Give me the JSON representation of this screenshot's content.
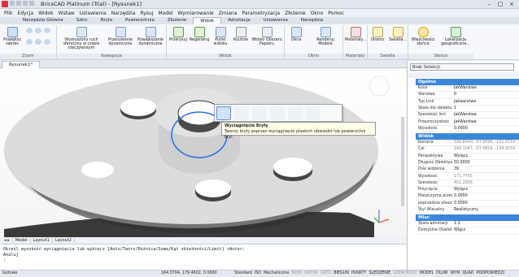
{
  "titlebar": {
    "title": "BricsCAD Platinum (Trial) - [Rysunek1]"
  },
  "menu": [
    "Plik",
    "Edycja",
    "Widok",
    "Wstaw",
    "Ustawienia",
    "Narzędzia",
    "Rysuj",
    "Model",
    "Wymiarowanie",
    "Zmiana",
    "Parametryzacja",
    "Złożenie",
    "Okno",
    "Pomoc"
  ],
  "ribbon_tabs": [
    "Narzędzia Główne",
    "Szkic",
    "Bryła",
    "Powierzchnia",
    "Złożenie",
    "Widok",
    "Adnotacja",
    "Ustawienia",
    "Narzędzia"
  ],
  "ribbon_active_tab": "Widok",
  "ribbon": {
    "zoom_label": "Zoom",
    "zoom_tool": "Powiększ zakres",
    "nav_label": "Nawigacja",
    "nav_tools": [
      "Wymuszony ruch sferyczny w czasie rzeczywistym",
      "Przesuwanie dynamiczne",
      "Powiększanie dynamiczne"
    ],
    "view_label": "Widok",
    "view_tools": [
      "Przerysuj",
      "Regeneruj",
      "Punkt widoku",
      "Rzutnie",
      "Widoki Obszaru Papieru"
    ],
    "window_label": "Okno",
    "window_tools": [
      "Okna",
      "Renderuj Modele"
    ],
    "materials_label": "Materiały",
    "materials_tool": "Materiały...",
    "lights_label": "Światła",
    "lights_tools": [
      "Utwórz",
      "Światła..."
    ],
    "sun_label": "Słońce",
    "sun_tools": [
      "Właściwości słońca",
      "Lokalizacja geograficzna..."
    ]
  },
  "doc_tab": "Rysunek1*",
  "layout_tabs": [
    "Model",
    "Layout1",
    "Layout2"
  ],
  "popup": {
    "tooltip_title": "Wyciągnięcie Bryły",
    "tooltip_text": "Tworzy bryły poprzez wyciągnięcie płaskich obwiedni lub powierzchni bryl"
  },
  "command": {
    "line1": "Określ wysokość wyciągnięcia lub wybierz [Auto/Twórz/Różnica/Suma/Kąt zbieżności/Limit] <Auto>:",
    "line2": "Anuluj",
    "prompt": ":"
  },
  "properties": {
    "selection": "Brak Selekcji",
    "sections": [
      {
        "title": "Ogólne",
        "rows": [
          {
            "k": "Kolor",
            "v": "JakWarstwa"
          },
          {
            "k": "Warstwa",
            "v": "0"
          },
          {
            "k": "Typ Linii",
            "v": "Jakwarstwa"
          },
          {
            "k": "Skala dla obiektu",
            "v": "1"
          },
          {
            "k": "Szerokość linii",
            "v": "JakWarstwa"
          },
          {
            "k": "Przezroczystość",
            "v": "JakWarstwa"
          },
          {
            "k": "Wysokość",
            "v": "0.0000"
          }
        ]
      },
      {
        "title": "Widok",
        "rows": [
          {
            "k": "Kamera",
            "v": "189.8640, -57.9596, -131.0519"
          },
          {
            "k": "Cel",
            "v": "189.1047, -57.4816, -134.9154"
          },
          {
            "k": "Perspektywa",
            "v": "Wyłącz"
          },
          {
            "k": "Długość Obiektywu",
            "v": "50.0000"
          },
          {
            "k": "Pole widzenia",
            "v": "39"
          },
          {
            "k": "Wysokość",
            "v": "171.7755"
          },
          {
            "k": "Szerokość",
            "v": "402.2656"
          },
          {
            "k": "Przycięcie",
            "v": "Wyłącz"
          },
          {
            "k": "Płaszczyzna przednia",
            "v": "0.0000"
          },
          {
            "k": "poprzednia płaszczyzna",
            "v": "0.0000"
          },
          {
            "k": "Styl Wizualny",
            "v": "Realistyczny"
          }
        ]
      },
      {
        "title": "Misc",
        "rows": [
          {
            "k": "Skala adnotacji",
            "v": "1:1"
          },
          {
            "k": "Domyślne Oświetlenie",
            "v": "Włącz"
          }
        ]
      }
    ]
  },
  "status": {
    "ready": "Gotowe",
    "coords": "164.3704, 179.4602, 0.0000",
    "toggles": [
      {
        "label": "Standard",
        "on": true
      },
      {
        "label": "ISO",
        "on": true
      },
      {
        "label": "Mechaniczne",
        "on": true
      },
      {
        "label": "SKOK",
        "on": false
      },
      {
        "label": "SIATKA",
        "on": false
      },
      {
        "label": "ORTO",
        "on": false
      },
      {
        "label": "BIEGUN",
        "on": true
      },
      {
        "label": "PUNKTY",
        "on": true
      },
      {
        "label": "ŚLEDZENIE",
        "on": true
      },
      {
        "label": "SZEROKOŚĆ",
        "on": false
      },
      {
        "label": "MODEL",
        "on": true
      },
      {
        "label": "DLUW",
        "on": true
      },
      {
        "label": "WYM",
        "on": true
      },
      {
        "label": "QUAD",
        "on": true
      },
      {
        "label": "PODPOWIEDZI",
        "on": true
      }
    ]
  },
  "colors": {
    "accent": "#3a87d9",
    "blue_circle": "#2f74e0",
    "plate": "#d9d9d9"
  }
}
